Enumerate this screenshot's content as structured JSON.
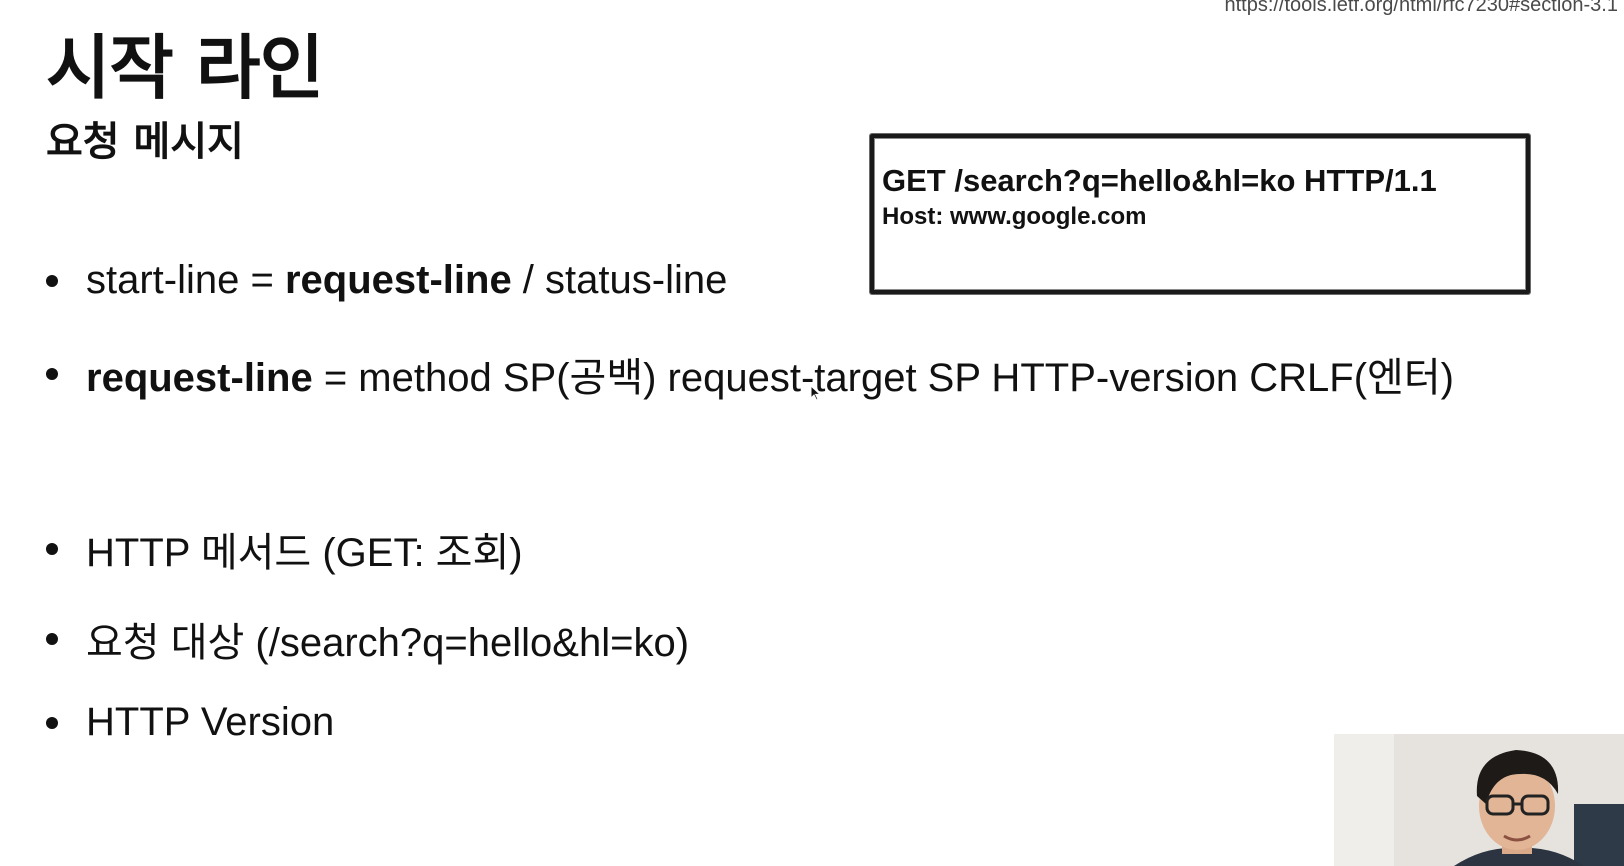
{
  "source_url": "https://tools.ietf.org/html/rfc7230#section-3.1",
  "title": "시작 라인",
  "subtitle": "요청 메시지",
  "example": {
    "line1": "GET /search?q=hello&hl=ko HTTP/1.1",
    "line2": "Host: www.google.com"
  },
  "bullets": [
    {
      "parts": [
        {
          "text": "start-line = "
        },
        {
          "text": "request-line",
          "bold": true
        },
        {
          "text": " / status-line"
        }
      ]
    },
    {
      "parts": [
        {
          "text": "request-line",
          "bold": true
        },
        {
          "text": " = method SP(공백) request-target SP HTTP-version CRLF(엔터)"
        }
      ]
    },
    {
      "parts": [
        {
          "text": "HTTP 메서드 (GET: 조회)"
        }
      ]
    },
    {
      "parts": [
        {
          "text": "요청 대상 (/search?q=hello&hl=ko)"
        }
      ]
    },
    {
      "parts": [
        {
          "text": "HTTP Version"
        }
      ]
    }
  ],
  "icons": {
    "bullet": "bullet-dot-icon",
    "cursor": "mouse-cursor-icon"
  },
  "webcam": {
    "description_icon": "presenter-webcam",
    "background_color": "#e4e2de"
  },
  "colors": {
    "text": "#111111",
    "url": "#4a4a4a",
    "box_border": "#1a1a1a",
    "background": "#ffffff"
  }
}
